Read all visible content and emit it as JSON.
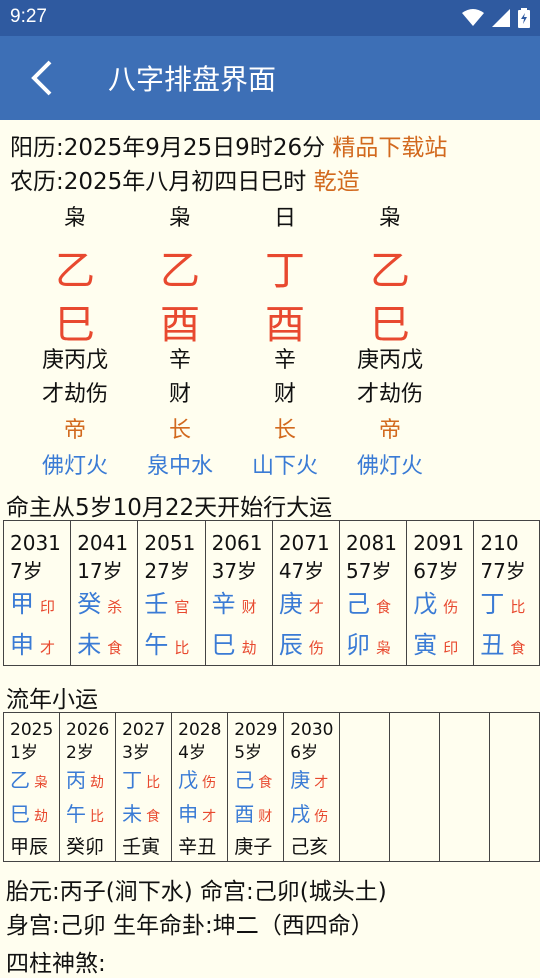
{
  "status": {
    "time": "9:27"
  },
  "appbar": {
    "title": "八字排盘界面"
  },
  "header": {
    "solar_prefix": "阳历:2025年9月25日9时26分",
    "solar_link": "精品下载站",
    "lunar_prefix": "农历:2025年八月初四日巳时",
    "lunar_tag": "乾造"
  },
  "pillars": [
    {
      "god": "枭",
      "stem": "乙",
      "branch": "巳",
      "hidden": "庚丙戊",
      "hidden_gods": "才劫伤",
      "stage": "帝",
      "nayin": "佛灯火"
    },
    {
      "god": "枭",
      "stem": "乙",
      "branch": "酉",
      "hidden": "辛",
      "hidden_gods": "财",
      "stage": "长",
      "nayin": "泉中水"
    },
    {
      "god": "日",
      "stem": "丁",
      "branch": "酉",
      "hidden": "辛",
      "hidden_gods": "财",
      "stage": "长",
      "nayin": "山下火"
    },
    {
      "god": "枭",
      "stem": "乙",
      "branch": "巳",
      "hidden": "庚丙戊",
      "hidden_gods": "才劫伤",
      "stage": "帝",
      "nayin": "佛灯火"
    }
  ],
  "dayun_title": "命主从5岁10月22天开始行大运",
  "dayun": [
    {
      "year": "2031",
      "age": "7岁",
      "stem": "甲",
      "stem_god": "印",
      "branch": "申",
      "branch_god": "才"
    },
    {
      "year": "2041",
      "age": "17岁",
      "stem": "癸",
      "stem_god": "杀",
      "branch": "未",
      "branch_god": "食"
    },
    {
      "year": "2051",
      "age": "27岁",
      "stem": "壬",
      "stem_god": "官",
      "branch": "午",
      "branch_god": "比"
    },
    {
      "year": "2061",
      "age": "37岁",
      "stem": "辛",
      "stem_god": "财",
      "branch": "巳",
      "branch_god": "劫"
    },
    {
      "year": "2071",
      "age": "47岁",
      "stem": "庚",
      "stem_god": "才",
      "branch": "辰",
      "branch_god": "伤"
    },
    {
      "year": "2081",
      "age": "57岁",
      "stem": "己",
      "stem_god": "食",
      "branch": "卯",
      "branch_god": "枭"
    },
    {
      "year": "2091",
      "age": "67岁",
      "stem": "戊",
      "stem_god": "伤",
      "branch": "寅",
      "branch_god": "印"
    },
    {
      "year": "210",
      "age": "77岁",
      "stem": "丁",
      "stem_god": "比",
      "branch": "丑",
      "branch_god": "食"
    }
  ],
  "liunian_title": "流年小运",
  "liunian": [
    {
      "year": "2025",
      "age": "1岁",
      "stem": "乙",
      "stem_god": "枭",
      "branch": "巳",
      "branch_god": "劫",
      "xiaoyun": "甲辰"
    },
    {
      "year": "2026",
      "age": "2岁",
      "stem": "丙",
      "stem_god": "劫",
      "branch": "午",
      "branch_god": "比",
      "xiaoyun": "癸卯"
    },
    {
      "year": "2027",
      "age": "3岁",
      "stem": "丁",
      "stem_god": "比",
      "branch": "未",
      "branch_god": "食",
      "xiaoyun": "壬寅"
    },
    {
      "year": "2028",
      "age": "4岁",
      "stem": "戊",
      "stem_god": "伤",
      "branch": "申",
      "branch_god": "才",
      "xiaoyun": "辛丑"
    },
    {
      "year": "2029",
      "age": "5岁",
      "stem": "己",
      "stem_god": "食",
      "branch": "酉",
      "branch_god": "财",
      "xiaoyun": "庚子"
    },
    {
      "year": "2030",
      "age": "6岁",
      "stem": "庚",
      "stem_god": "才",
      "branch": "戌",
      "branch_god": "伤",
      "xiaoyun": "己亥"
    }
  ],
  "footer": {
    "line1": "胎元:丙子(涧下水) 命宫:己卯(城头土)",
    "line2": "身宫:己卯  生年命卦:坤二（西四命）",
    "line3": "四柱神煞:"
  },
  "colors": {
    "statusbar": "#2F5AA0",
    "appbar": "#3D6FB6",
    "background": "#FFFEEF",
    "red": "#E8492F",
    "blue": "#3A7BD5",
    "orange": "#D2691E"
  }
}
